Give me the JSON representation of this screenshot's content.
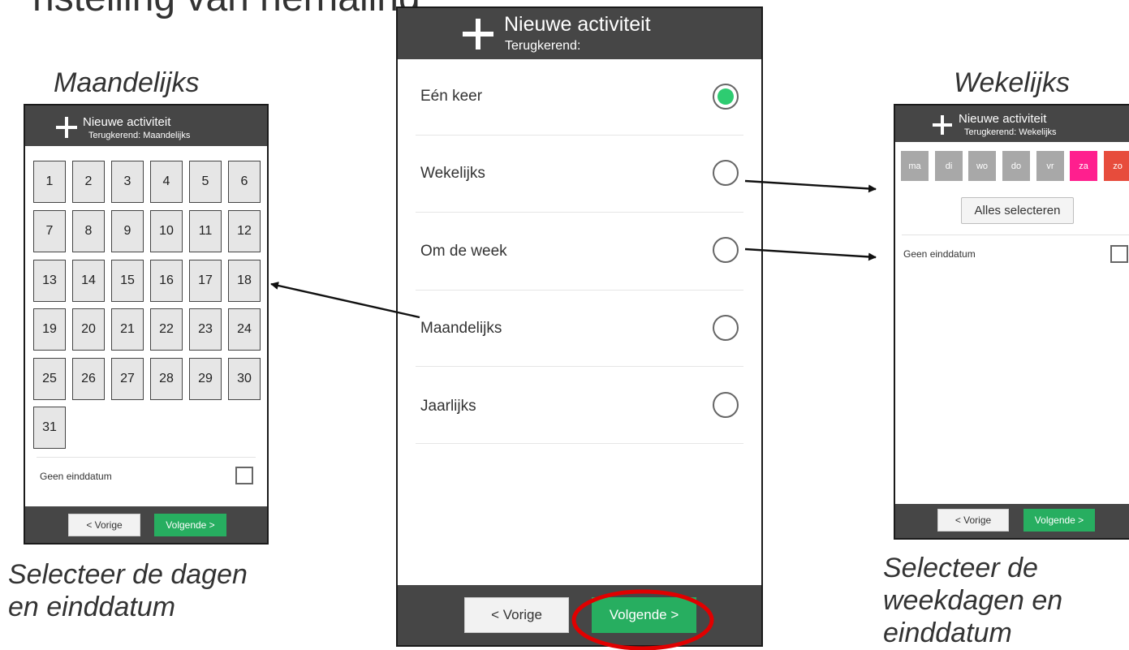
{
  "captions": {
    "cut_title": "nstelling van herhaling",
    "maandelijks": "Maandelijks",
    "wekelijks": "Wekelijks",
    "left_bottom_line1": "Selecteer de dagen",
    "left_bottom_line2": "en einddatum",
    "right_bottom_line1": "Selecteer de",
    "right_bottom_line2": "weekdagen en",
    "right_bottom_line3": "einddatum"
  },
  "center": {
    "header": {
      "title": "Nieuwe activiteit",
      "subtitle": "Terugkerend:"
    },
    "options": [
      {
        "label": "Eén keer",
        "selected": true
      },
      {
        "label": "Wekelijks",
        "selected": false
      },
      {
        "label": "Om de week",
        "selected": false
      },
      {
        "label": "Maandelijks",
        "selected": false
      },
      {
        "label": "Jaarlijks",
        "selected": false
      }
    ],
    "prev_label": "< Vorige",
    "next_label": "Volgende >",
    "highlight_color": "#e00000"
  },
  "monthly": {
    "header": {
      "title": "Nieuwe activiteit",
      "subtitle": "Terugkerend: Maandelijks"
    },
    "days": [
      "1",
      "2",
      "3",
      "4",
      "5",
      "6",
      "7",
      "8",
      "9",
      "10",
      "11",
      "12",
      "13",
      "14",
      "15",
      "16",
      "17",
      "18",
      "19",
      "20",
      "21",
      "22",
      "23",
      "24",
      "25",
      "26",
      "27",
      "28",
      "29",
      "30",
      "31"
    ],
    "no_end_date_label": "Geen einddatum",
    "no_end_date_checked": false,
    "prev_label": "< Vorige",
    "next_label": "Volgende >"
  },
  "weekly": {
    "header": {
      "title": "Nieuwe activiteit",
      "subtitle": "Terugkerend: Wekelijks"
    },
    "weekdays": [
      {
        "label": "ma",
        "color": "#a8a8a8"
      },
      {
        "label": "di",
        "color": "#a8a8a8"
      },
      {
        "label": "wo",
        "color": "#a8a8a8"
      },
      {
        "label": "do",
        "color": "#a8a8a8"
      },
      {
        "label": "vr",
        "color": "#a8a8a8"
      },
      {
        "label": "za",
        "color": "#ff1f8e"
      },
      {
        "label": "zo",
        "color": "#e74c3c"
      }
    ],
    "select_all_label": "Alles selecteren",
    "no_end_date_label": "Geen einddatum",
    "no_end_date_checked": false,
    "prev_label": "< Vorige",
    "next_label": "Volgende >"
  },
  "colors": {
    "header_bg": "#464646",
    "next_button": "#27ae60",
    "radio_selected": "#2ecc71"
  }
}
